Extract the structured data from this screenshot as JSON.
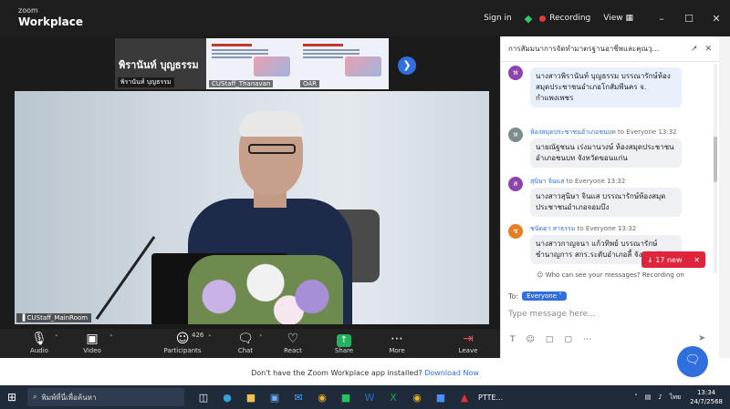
{
  "window": {
    "logo_top": "zoom",
    "logo_bottom": "Workplace",
    "sign_in": "Sign in",
    "recording": "Recording",
    "view": "View",
    "minimize": "–",
    "maximize": "☐",
    "close": "✕"
  },
  "gallery": {
    "tile1_name": "พิรานันท์ บุญธรรม",
    "tile1_label": "พิรานันท์ บุญธรรม",
    "tile2_label": "CUStaff_Thanavan",
    "tile3_label": "OAR"
  },
  "video": {
    "label": "CUStaff_MainRoom"
  },
  "toolbar": {
    "audio": "Audio",
    "video": "Video",
    "participants": "Participants",
    "participants_count": "426",
    "chat": "Chat",
    "react": "React",
    "share": "Share",
    "more": "More",
    "leave": "Leave"
  },
  "chat": {
    "title": "การสัมมนาการจัดทำมาตรฐานอาชีพและคุณวุ...",
    "messages": [
      {
        "avatar": "พ",
        "color": "#8e44ad",
        "sender": "",
        "to": "",
        "time": "",
        "text": "นางสาวพิรานันท์ บุญธรรม บรรณารักษ์ห้องสมุดประชาชนอำเภอโกสัมพีนคร จ. กำแพงเพชร"
      },
      {
        "avatar": "ห",
        "color": "#7f8c8d",
        "sender": "ห้องสมุดประชาชนอำเภอชนบท",
        "to": "to Everyone",
        "time": "13:32",
        "text": "นายณัฐชนน เร่งมานวงษ์ ห้องสมุดประชาชนอำเภอชนบท จังหวัดขอนแก่น"
      },
      {
        "avatar": "ส",
        "color": "#8e44ad",
        "sender": "สุนิษา จินแส",
        "to": "to Everyone",
        "time": "13:32",
        "text": "นางสาวสุนิษา จินแส บรรณารักษ์ห้องสมุดประชาชนอำเภอจอมบึง"
      },
      {
        "avatar": "ช",
        "color": "#e67e22",
        "sender": "ชนัดดา สาธรรม",
        "to": "to Everyone",
        "time": "13:32",
        "text": "นางสาวกาญจนา แก้วทิพย์ บรรณารักษ์ชำนาญการ สกร.ระดับอำเภอลี้ จังหวัดลำพูน"
      }
    ],
    "new_count": "17 new",
    "who_can_see": "Who can see your messages? Recording on",
    "to_label": "To:",
    "to_target": "Everyone",
    "input_placeholder": "Type message here..."
  },
  "page": {
    "download_prompt": "Don't have the Zoom Workplace app installed?",
    "download_link": "Download Now"
  },
  "taskbar": {
    "search_placeholder": "พิมพ์ที่นี่เพื่อค้นหา",
    "pinned_app": "PTTE...",
    "lang": "ไทย",
    "time": "13:34",
    "date": "24/7/2568"
  }
}
